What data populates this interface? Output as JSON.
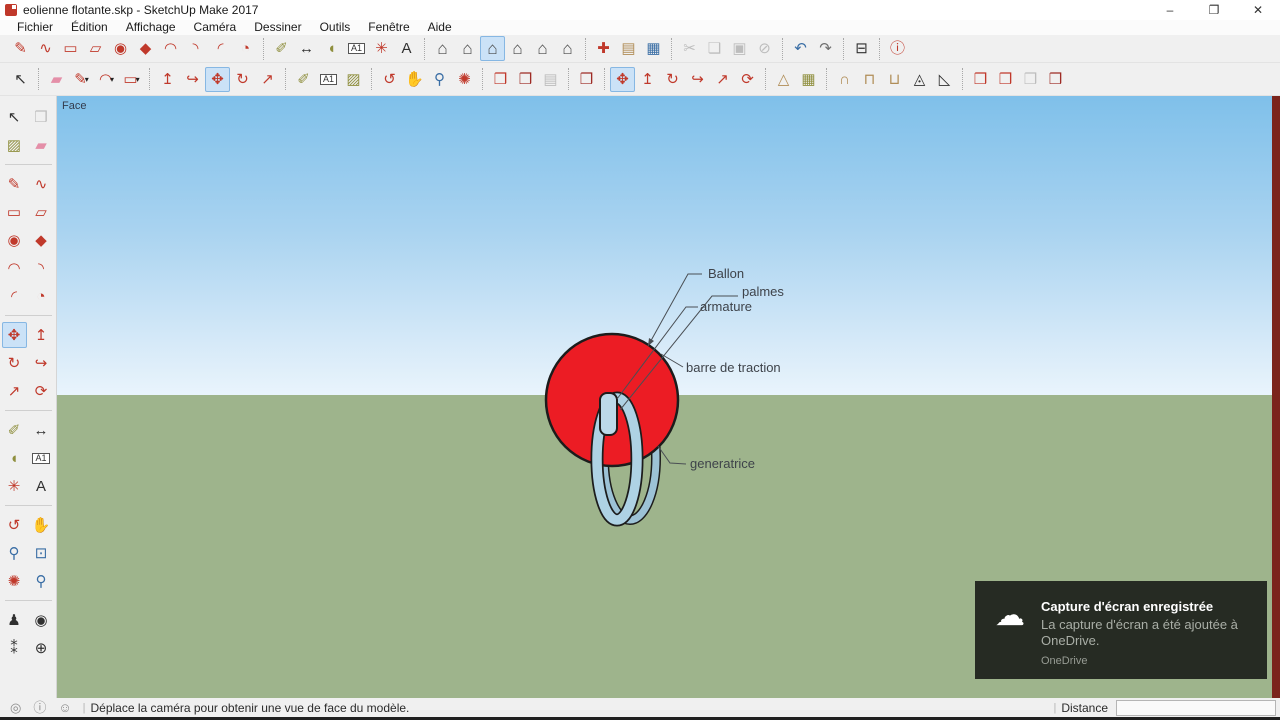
{
  "window": {
    "title": "eolienne flotante.skp - SketchUp Make 2017",
    "minimize": "–",
    "maximize": "❐",
    "close": "✕"
  },
  "menubar": [
    "Fichier",
    "Édition",
    "Affichage",
    "Caméra",
    "Dessiner",
    "Outils",
    "Fenêtre",
    "Aide"
  ],
  "toolbars": {
    "row1": [
      [
        {
          "n": "line-tool",
          "g": "✎",
          "c": "red"
        },
        {
          "n": "freehand-tool",
          "g": "∿",
          "c": "red"
        },
        {
          "n": "rectangle-tool",
          "g": "▭",
          "c": "red"
        },
        {
          "n": "rotated-rectangle-tool",
          "g": "▱",
          "c": "red"
        },
        {
          "n": "circle-tool",
          "g": "◉",
          "c": "red"
        },
        {
          "n": "polygon-tool",
          "g": "◆",
          "c": "red"
        },
        {
          "n": "arc-tool",
          "g": "◠",
          "c": "red"
        },
        {
          "n": "two-point-arc-tool",
          "g": "◝",
          "c": "red"
        },
        {
          "n": "three-point-arc-tool",
          "g": "◜",
          "c": "red"
        },
        {
          "n": "pie-tool",
          "g": "◔",
          "c": "red"
        }
      ],
      [
        {
          "n": "tape-measure-tool",
          "g": "✐",
          "c": "olive"
        },
        {
          "n": "dimension-tool",
          "g": "↔",
          "c": "dark"
        },
        {
          "n": "protractor-tool",
          "g": "◖",
          "c": "olive"
        },
        {
          "n": "text-tool",
          "g": "A1",
          "boxed": true
        },
        {
          "n": "axes-tool",
          "g": "✳",
          "c": "red"
        },
        {
          "n": "3d-text-tool",
          "g": "A",
          "c": "dark"
        }
      ],
      [
        {
          "n": "view-iso",
          "g": "⌂",
          "c": "house"
        },
        {
          "n": "view-top",
          "g": "⌂",
          "c": "house"
        },
        {
          "n": "view-front",
          "g": "⌂",
          "c": "house",
          "active": true
        },
        {
          "n": "view-right",
          "g": "⌂",
          "c": "house"
        },
        {
          "n": "view-back",
          "g": "⌂",
          "c": "house"
        },
        {
          "n": "view-left",
          "g": "⌂",
          "c": "house"
        }
      ],
      [
        {
          "n": "new-file",
          "g": "✚",
          "c": "red"
        },
        {
          "n": "open-file",
          "g": "▤",
          "c": "tan"
        },
        {
          "n": "save-file",
          "g": "▦",
          "c": "blue"
        }
      ],
      [
        {
          "n": "cut",
          "g": "✂",
          "c": "grey",
          "disabled": true
        },
        {
          "n": "copy",
          "g": "❏",
          "c": "grey",
          "disabled": true
        },
        {
          "n": "paste",
          "g": "▣",
          "c": "grey",
          "disabled": true
        },
        {
          "n": "erase",
          "g": "⊘",
          "c": "grey",
          "disabled": true
        }
      ],
      [
        {
          "n": "undo",
          "g": "↶",
          "c": "blue"
        },
        {
          "n": "redo",
          "g": "↷",
          "c": "grey"
        }
      ],
      [
        {
          "n": "print",
          "g": "⊟",
          "c": "dark"
        }
      ],
      [
        {
          "n": "model-info",
          "g": "ⓘ",
          "c": "red"
        }
      ]
    ],
    "row2": [
      [
        {
          "n": "select-tool",
          "g": "↖",
          "c": "dark"
        }
      ],
      [
        {
          "n": "eraser-tool",
          "g": "▰",
          "c": "pink"
        },
        {
          "n": "line-tool",
          "g": "✎",
          "c": "red",
          "dd": true
        },
        {
          "n": "arc-tool",
          "g": "◠",
          "c": "red",
          "dd": true
        },
        {
          "n": "rectangle-tool",
          "g": "▭",
          "c": "red",
          "dd": true
        }
      ],
      [
        {
          "n": "push-pull-tool",
          "g": "↥",
          "c": "red"
        },
        {
          "n": "follow-me-tool",
          "g": "↪",
          "c": "red"
        },
        {
          "n": "move-tool",
          "g": "✥",
          "c": "red",
          "active": true
        },
        {
          "n": "rotate-tool",
          "g": "↻",
          "c": "red"
        },
        {
          "n": "scale-tool",
          "g": "↗",
          "c": "red"
        }
      ],
      [
        {
          "n": "tape-measure-tool",
          "g": "✐",
          "c": "olive"
        },
        {
          "n": "text-tool",
          "g": "A1",
          "boxed": true
        },
        {
          "n": "paint-bucket-tool",
          "g": "▨",
          "c": "olive"
        }
      ],
      [
        {
          "n": "orbit-tool",
          "g": "↺",
          "c": "red"
        },
        {
          "n": "pan-tool",
          "g": "✋",
          "c": "tan"
        },
        {
          "n": "zoom-tool",
          "g": "⚲",
          "c": "blue"
        },
        {
          "n": "zoom-extents",
          "g": "✺",
          "c": "red"
        }
      ],
      [
        {
          "n": "3d-warehouse",
          "g": "❒",
          "c": "red"
        },
        {
          "n": "share-model",
          "g": "❒",
          "c": "dred"
        },
        {
          "n": "send-to-layout",
          "g": "▤",
          "c": "grey",
          "disabled": true
        }
      ],
      [
        {
          "n": "extension-warehouse",
          "g": "❒",
          "c": "dred"
        }
      ],
      [
        {
          "n": "move-tool",
          "g": "✥",
          "c": "red",
          "active": true
        },
        {
          "n": "push-pull-tool",
          "g": "↥",
          "c": "red"
        },
        {
          "n": "rotate-tool",
          "g": "↻",
          "c": "red"
        },
        {
          "n": "follow-me-tool",
          "g": "↪",
          "c": "red"
        },
        {
          "n": "scale-tool",
          "g": "↗",
          "c": "red"
        },
        {
          "n": "offset-tool",
          "g": "⟳",
          "c": "red"
        }
      ],
      [
        {
          "n": "sandbox-from-contours",
          "g": "△",
          "c": "tan"
        },
        {
          "n": "sandbox-from-scratch",
          "g": "▦",
          "c": "olive"
        }
      ],
      [
        {
          "n": "smoove-tool",
          "g": "∩",
          "c": "tan"
        },
        {
          "n": "stamp-tool",
          "g": "⊓",
          "c": "tan"
        },
        {
          "n": "drape-tool",
          "g": "⊔",
          "c": "tan"
        },
        {
          "n": "add-detail-tool",
          "g": "◬",
          "c": "dark"
        },
        {
          "n": "flip-edge-tool",
          "g": "◺",
          "c": "dark"
        }
      ],
      [
        {
          "n": "get-models",
          "g": "❒",
          "c": "red"
        },
        {
          "n": "share-model-upload",
          "g": "❒",
          "c": "red"
        },
        {
          "n": "share-component",
          "g": "❒",
          "c": "grey",
          "disabled": true
        },
        {
          "n": "extension-warehouse-2",
          "g": "❒",
          "c": "dred"
        }
      ]
    ],
    "palette": [
      [
        {
          "n": "select-tool",
          "g": "↖",
          "c": "dark"
        },
        {
          "n": "make-component",
          "g": "❒",
          "c": "grey",
          "disabled": true
        },
        {
          "n": "paint-bucket-tool",
          "g": "▨",
          "c": "olive"
        },
        {
          "n": "eraser-tool",
          "g": "▰",
          "c": "pink"
        }
      ],
      [
        {
          "n": "line-tool",
          "g": "✎",
          "c": "red"
        },
        {
          "n": "freehand-tool",
          "g": "∿",
          "c": "red"
        },
        {
          "n": "rectangle-tool",
          "g": "▭",
          "c": "red"
        },
        {
          "n": "rotated-rectangle-tool",
          "g": "▱",
          "c": "red"
        },
        {
          "n": "circle-tool",
          "g": "◉",
          "c": "red"
        },
        {
          "n": "polygon-tool",
          "g": "◆",
          "c": "red"
        },
        {
          "n": "arc-tool",
          "g": "◠",
          "c": "red"
        },
        {
          "n": "two-point-arc-tool",
          "g": "◝",
          "c": "red"
        },
        {
          "n": "three-point-arc-tool",
          "g": "◜",
          "c": "red"
        },
        {
          "n": "pie-tool",
          "g": "◔",
          "c": "red"
        }
      ],
      [
        {
          "n": "move-tool",
          "g": "✥",
          "c": "red",
          "active": true
        },
        {
          "n": "push-pull-tool",
          "g": "↥",
          "c": "red"
        },
        {
          "n": "rotate-tool",
          "g": "↻",
          "c": "red"
        },
        {
          "n": "follow-me-tool",
          "g": "↪",
          "c": "red"
        },
        {
          "n": "scale-tool",
          "g": "↗",
          "c": "red"
        },
        {
          "n": "offset-tool",
          "g": "⟳",
          "c": "red"
        }
      ],
      [
        {
          "n": "tape-measure-tool",
          "g": "✐",
          "c": "olive"
        },
        {
          "n": "dimension-tool",
          "g": "↔",
          "c": "dark"
        },
        {
          "n": "protractor-tool",
          "g": "◖",
          "c": "olive"
        },
        {
          "n": "text-tool",
          "g": "A1",
          "boxed": true
        },
        {
          "n": "axes-tool",
          "g": "✳",
          "c": "red"
        },
        {
          "n": "3d-text-tool",
          "g": "A",
          "c": "dark"
        }
      ],
      [
        {
          "n": "orbit-tool",
          "g": "↺",
          "c": "red"
        },
        {
          "n": "pan-tool",
          "g": "✋",
          "c": "tan"
        },
        {
          "n": "zoom-tool",
          "g": "⚲",
          "c": "blue"
        },
        {
          "n": "zoom-window-tool",
          "g": "⊡",
          "c": "blue"
        },
        {
          "n": "zoom-extents",
          "g": "✺",
          "c": "red"
        },
        {
          "n": "zoom-previous",
          "g": "⚲",
          "c": "blue"
        }
      ],
      [
        {
          "n": "position-camera-tool",
          "g": "♟",
          "c": "dark"
        },
        {
          "n": "look-around-tool",
          "g": "◉",
          "c": "dark"
        },
        {
          "n": "walk-tool",
          "g": "⁑",
          "c": "dark"
        },
        {
          "n": "section-plane-tool",
          "g": "⊕",
          "c": "dark"
        }
      ]
    ]
  },
  "viewport": {
    "face_label": "Face",
    "labels": {
      "ballon": "Ballon",
      "palmes": "palmes",
      "armature": "armature",
      "barre_de_traction": "barre de traction",
      "generatrice": "generatrice"
    }
  },
  "toast": {
    "icon": "onedrive-cloud",
    "icon_glyph": "☁",
    "title": "Capture d'écran enregistrée",
    "body": "La capture d'écran a été ajoutée à OneDrive.",
    "app": "OneDrive"
  },
  "statusbar": {
    "icons": [
      {
        "n": "status-geolocation",
        "g": "◎"
      },
      {
        "n": "status-claim-credit",
        "g": "ⓘ"
      },
      {
        "n": "status-sign-in",
        "g": "☺"
      }
    ],
    "message": "Déplace la caméra pour obtenir une vue de face du modèle.",
    "distance_label": "Distance",
    "distance_value": ""
  },
  "colors": {
    "sky_top": "#7fc0ea",
    "sky_horizon": "#e9f4fc",
    "ground": "#9eb48c",
    "balloon_red": "#ec1c24",
    "ring_blue": "#aed2e4",
    "active_highlight": "#cbe2f7",
    "toast_bg": "#262b23",
    "window_edge_red": "#7b241c"
  }
}
